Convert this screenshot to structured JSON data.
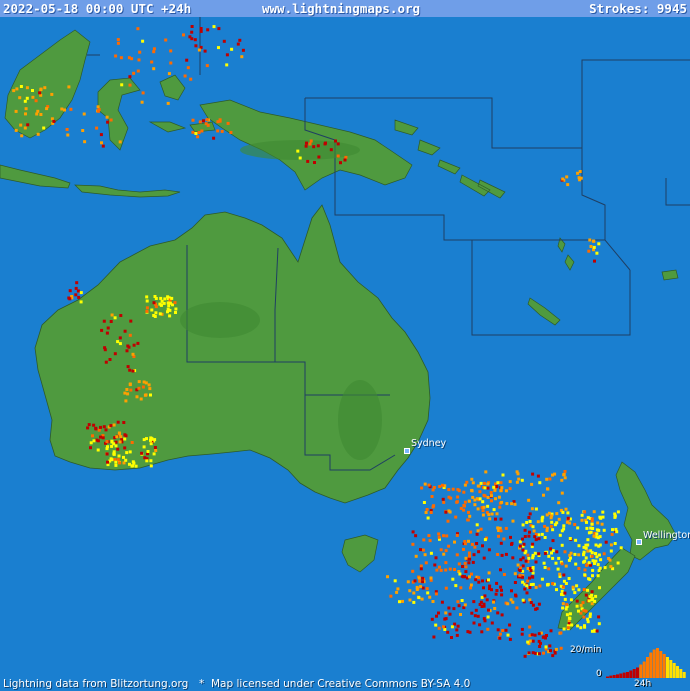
{
  "header": {
    "datetime": "2022-05-18 00:00 UTC +24h",
    "site": "www.lightningmaps.org",
    "strokes": "Strokes: 9945"
  },
  "footer": {
    "source": "Lightning data from Blitzortung.org",
    "separator": "*",
    "license": "Map licensed under Creative Commons BY-SA 4.0"
  },
  "cities": {
    "sydney": "Sydney",
    "wellington": "Wellington"
  },
  "histogram": {
    "rate_label": "20/min",
    "zero_label": "0",
    "time_label": "24h",
    "bars": [
      0.05,
      0.08,
      0.1,
      0.12,
      0.15,
      0.18,
      0.2,
      0.25,
      0.3,
      0.35,
      0.45,
      0.55,
      0.7,
      0.85,
      0.95,
      1.0,
      0.9,
      0.8,
      0.7,
      0.6,
      0.5,
      0.4,
      0.3,
      0.2
    ]
  },
  "colors": {
    "sea": "#1a7fd0",
    "land": "#4f9a3f",
    "land_dark": "#3f8a32",
    "border": "#1f3f63",
    "strike_recent": "#ffff00",
    "strike_mid": "#ffa000",
    "strike_old": "#c00000"
  }
}
